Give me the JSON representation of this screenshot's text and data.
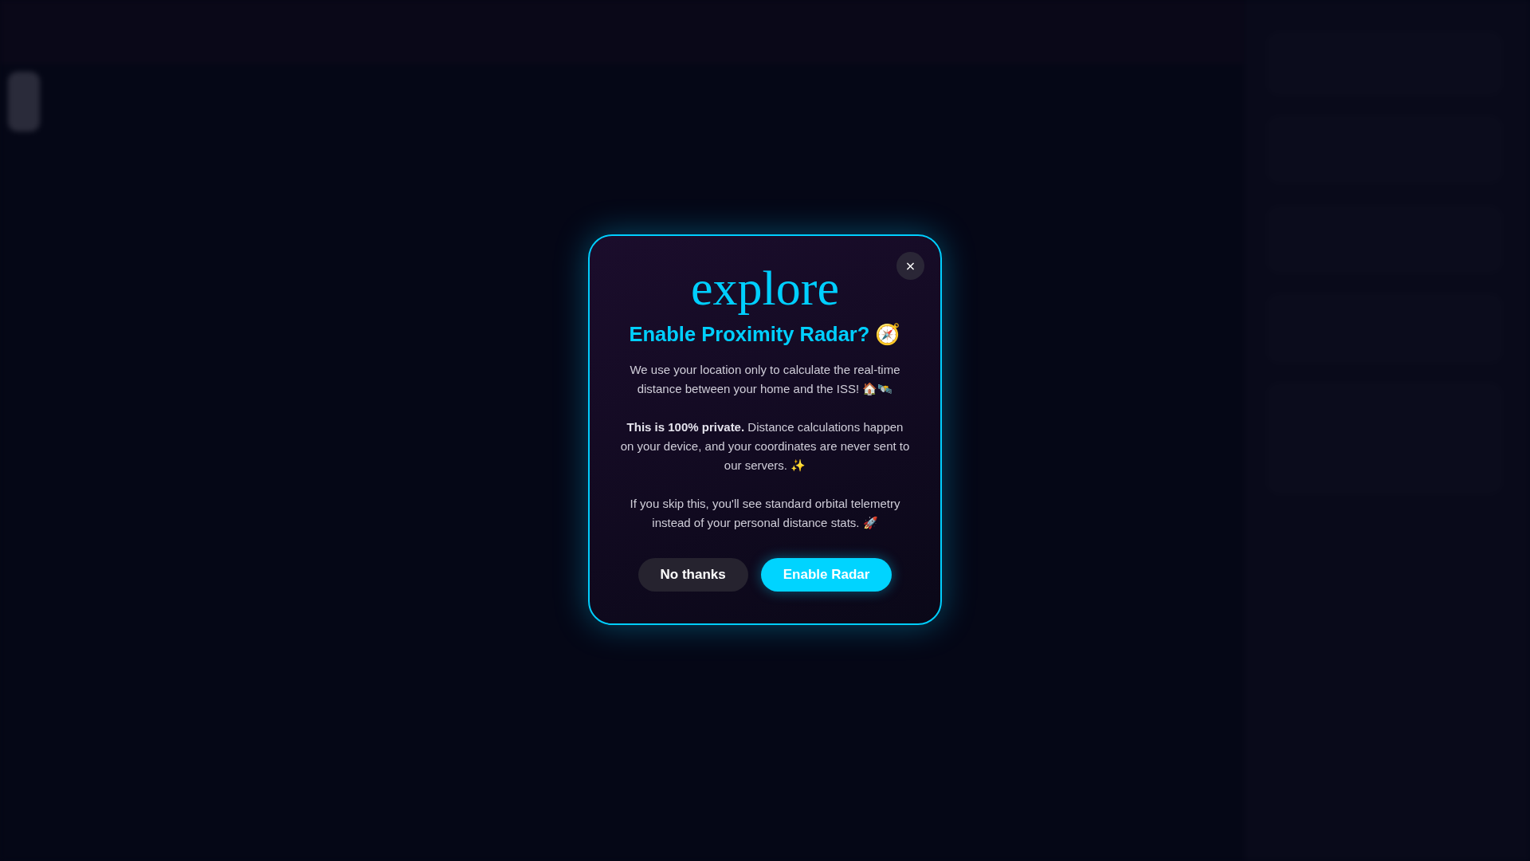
{
  "dialog": {
    "close_label": "×",
    "brand": "explore",
    "title": "Enable Proximity Radar? 🧭",
    "paragraphs": [
      "We use your location only to calculate the real-time distance between your home and the ISS! 🏠🛰️",
      "**This is 100% private.** Distance calculations happen on your device, and your coordinates are never sent to our servers. ✨",
      "If you skip this, you'll see standard orbital telemetry instead of your personal distance stats. 🚀"
    ],
    "buttons": [
      {
        "label": "No thanks",
        "kind": "secondary"
      },
      {
        "label": "Enable Radar",
        "kind": "primary"
      }
    ]
  }
}
